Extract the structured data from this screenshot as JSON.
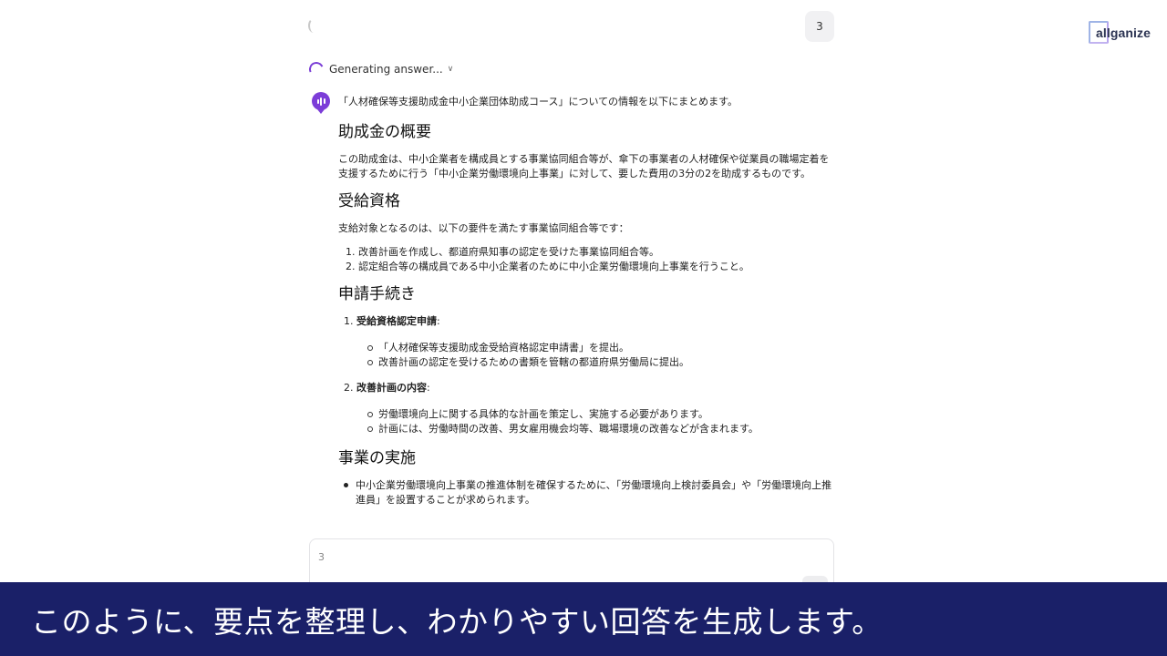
{
  "top_badge": "3",
  "brand": {
    "name": "allganize"
  },
  "status": {
    "text": "Generating answer..."
  },
  "answer": {
    "intro": "「人材確保等支援助成金中小企業団体助成コース」についての情報を以下にまとめます。",
    "sections": {
      "overview": {
        "heading": "助成金の概要",
        "body": "この助成金は、中小企業者を構成員とする事業協同組合等が、傘下の事業者の人材確保や従業員の職場定着を支援するために行う「中小企業労働環境向上事業」に対して、要した費用の3分の2を助成するものです。"
      },
      "eligibility": {
        "heading": "受給資格",
        "body": "支給対象となるのは、以下の要件を満たす事業協同組合等です：",
        "items": [
          "1. 改善計画を作成し、都道府県知事の認定を受けた事業協同組合等。",
          "2. 認定組合等の構成員である中小企業者のために中小企業労働環境向上事業を行うこと。"
        ]
      },
      "procedure": {
        "heading": "申請手続き",
        "steps": [
          {
            "num": "1. ",
            "title": "受給資格認定申請",
            "suffix": ":",
            "items": [
              "「人材確保等支援助成金受給資格認定申請書」を提出。",
              "改善計画の認定を受けるための書類を管轄の都道府県労働局に提出。"
            ]
          },
          {
            "num": "2. ",
            "title": "改善計画の内容",
            "suffix": ":",
            "items": [
              "労働環境向上に関する具体的な計画を策定し、実施する必要があります。",
              "計画には、労働時間の改善、男女雇用機会均等、職場環境の改善などが含まれます。"
            ]
          }
        ]
      },
      "implementation": {
        "heading": "事業の実施",
        "items": [
          "中小企業労働環境向上事業の推進体制を確保するために、「労働環境向上検討委員会」や「労働環境向上推進員」を設置することが求められます。"
        ]
      }
    }
  },
  "composer": {
    "value": "3"
  },
  "subtitle": "このように、要点を整理し、わかりやすい回答を生成します。",
  "colors": {
    "accent": "#7c3dd8",
    "subtitle_bg": "#1a2068"
  }
}
